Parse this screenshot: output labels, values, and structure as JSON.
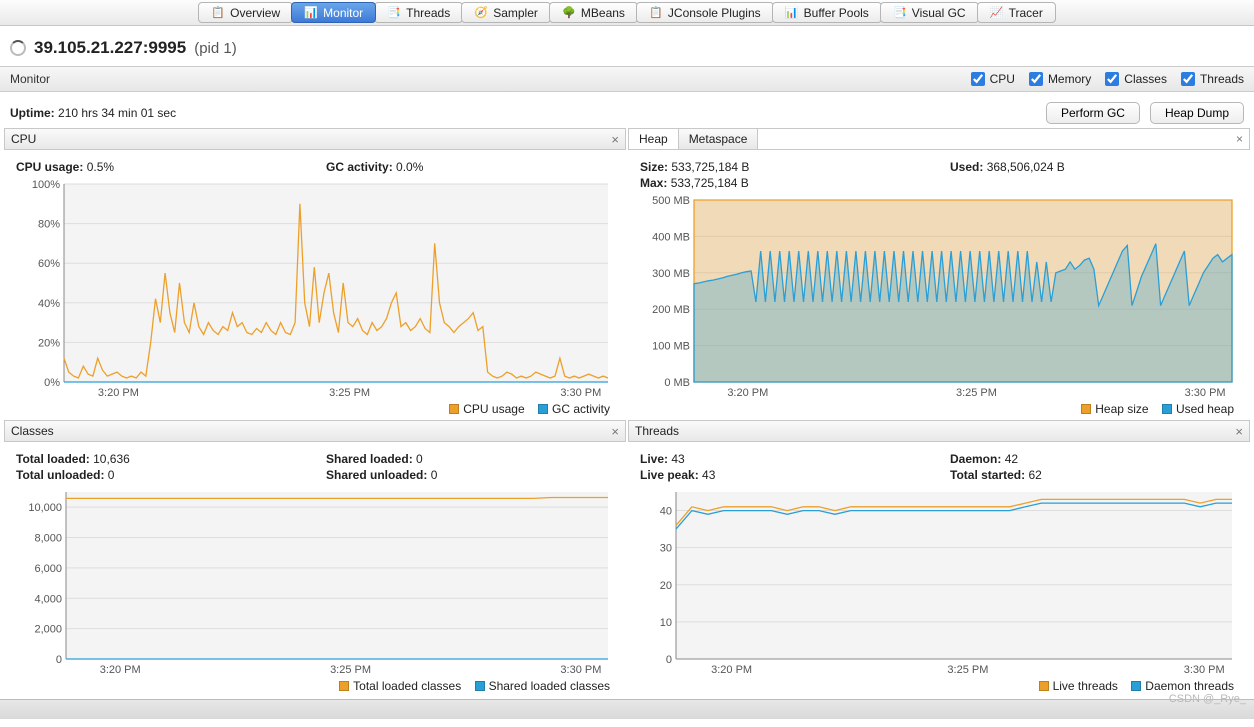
{
  "tabs": [
    {
      "label": "Overview",
      "icon": "📋"
    },
    {
      "label": "Monitor",
      "icon": "📊",
      "active": true
    },
    {
      "label": "Threads",
      "icon": "📑"
    },
    {
      "label": "Sampler",
      "icon": "🧭"
    },
    {
      "label": "MBeans",
      "icon": "🌳"
    },
    {
      "label": "JConsole Plugins",
      "icon": "📋"
    },
    {
      "label": "Buffer Pools",
      "icon": "📊"
    },
    {
      "label": "Visual GC",
      "icon": "📑"
    },
    {
      "label": "Tracer",
      "icon": "📈"
    }
  ],
  "header": {
    "title": "39.105.21.227:9995",
    "suffix": "(pid 1)"
  },
  "toolbar": {
    "label": "Monitor",
    "checks": [
      "CPU",
      "Memory",
      "Classes",
      "Threads"
    ]
  },
  "uptime": {
    "label": "Uptime:",
    "value": "210 hrs 34 min 01 sec"
  },
  "buttons": {
    "gc": "Perform GC",
    "dump": "Heap Dump"
  },
  "panels": {
    "cpu": {
      "title": "CPU",
      "stats": [
        {
          "label": "CPU usage:",
          "value": "0.5%"
        },
        {
          "label": "GC activity:",
          "value": "0.0%"
        }
      ],
      "legend": [
        {
          "color": "#eca02a",
          "text": "CPU usage"
        },
        {
          "color": "#2a9fd6",
          "text": "GC activity"
        }
      ]
    },
    "heap": {
      "tabs": [
        "Heap",
        "Metaspace"
      ],
      "stats_left": [
        {
          "label": "Size:",
          "value": "533,725,184 B"
        },
        {
          "label": "Max:",
          "value": "533,725,184 B"
        }
      ],
      "stats_right": [
        {
          "label": "Used:",
          "value": "368,506,024 B"
        }
      ],
      "legend": [
        {
          "color": "#eca02a",
          "text": "Heap size"
        },
        {
          "color": "#2a9fd6",
          "text": "Used heap"
        }
      ]
    },
    "classes": {
      "title": "Classes",
      "stats_left": [
        {
          "label": "Total loaded:",
          "value": "10,636"
        },
        {
          "label": "Total unloaded:",
          "value": "0"
        }
      ],
      "stats_right": [
        {
          "label": "Shared loaded:",
          "value": "0"
        },
        {
          "label": "Shared unloaded:",
          "value": "0"
        }
      ],
      "legend": [
        {
          "color": "#eca02a",
          "text": "Total loaded classes"
        },
        {
          "color": "#2a9fd6",
          "text": "Shared loaded classes"
        }
      ]
    },
    "threads": {
      "title": "Threads",
      "stats_left": [
        {
          "label": "Live:",
          "value": "43"
        },
        {
          "label": "Live peak:",
          "value": "43"
        }
      ],
      "stats_right": [
        {
          "label": "Daemon:",
          "value": "42"
        },
        {
          "label": "Total started:",
          "value": "62"
        }
      ],
      "legend": [
        {
          "color": "#eca02a",
          "text": "Live threads"
        },
        {
          "color": "#2a9fd6",
          "text": "Daemon threads"
        }
      ]
    }
  },
  "watermark": "CSDN @_Rye_",
  "chart_data": [
    {
      "type": "line",
      "title": "CPU",
      "x_ticks": [
        "3:20 PM",
        "3:25 PM",
        "3:30 PM"
      ],
      "ylim": [
        0,
        100
      ],
      "ylabel": "%",
      "y_ticks": [
        0,
        20,
        40,
        60,
        80,
        100
      ],
      "series": [
        {
          "name": "CPU usage",
          "color": "#eca02a",
          "values": [
            12,
            5,
            3,
            2,
            8,
            4,
            3,
            12,
            6,
            3,
            4,
            5,
            3,
            2,
            3,
            2,
            5,
            3,
            20,
            42,
            30,
            55,
            35,
            25,
            50,
            30,
            25,
            40,
            28,
            24,
            30,
            26,
            24,
            28,
            26,
            35,
            28,
            30,
            25,
            24,
            27,
            25,
            30,
            26,
            24,
            30,
            25,
            24,
            30,
            90,
            40,
            28,
            58,
            30,
            45,
            55,
            35,
            25,
            50,
            30,
            28,
            32,
            26,
            24,
            30,
            26,
            28,
            32,
            40,
            45,
            28,
            30,
            26,
            28,
            32,
            27,
            25,
            70,
            40,
            30,
            28,
            25,
            28,
            30,
            32,
            35,
            26,
            28,
            5,
            3,
            2,
            3,
            5,
            4,
            2,
            3,
            2,
            3,
            5,
            4,
            3,
            2,
            3,
            12,
            3,
            2,
            3,
            2,
            3,
            4,
            3,
            2,
            3,
            2
          ]
        },
        {
          "name": "GC activity",
          "color": "#2a9fd6",
          "values": [
            0,
            0,
            0,
            0,
            0,
            0,
            0,
            0,
            0,
            0,
            0,
            0,
            0,
            0,
            0,
            0,
            0,
            0,
            0,
            0,
            0,
            0,
            0,
            0,
            0,
            0,
            0,
            0,
            0,
            0,
            0,
            0,
            0,
            0,
            0,
            0,
            0,
            0,
            0,
            0,
            0,
            0,
            0,
            0,
            0,
            0,
            0,
            0,
            0,
            0,
            0,
            0,
            0,
            0,
            0,
            0,
            0,
            0,
            0,
            0,
            0,
            0,
            0,
            0,
            0,
            0,
            0,
            0,
            0,
            0,
            0,
            0,
            0,
            0,
            0,
            0,
            0,
            0,
            0,
            0,
            0,
            0,
            0,
            0,
            0,
            0,
            0,
            0,
            0,
            0,
            0,
            0,
            0,
            0,
            0,
            0,
            0,
            0,
            0,
            0,
            0,
            0,
            0,
            0,
            0,
            0,
            0,
            0,
            0,
            0,
            0,
            0,
            0,
            0
          ]
        }
      ]
    },
    {
      "type": "area",
      "title": "Heap",
      "x_ticks": [
        "3:20 PM",
        "3:25 PM",
        "3:30 PM"
      ],
      "ylim": [
        0,
        500
      ],
      "ylabel": "MB",
      "y_ticks": [
        0,
        100,
        200,
        300,
        400,
        500
      ],
      "series": [
        {
          "name": "Heap size",
          "color": "#eca02a",
          "fill": true,
          "values": [
            500,
            500,
            500,
            500,
            500,
            500,
            500,
            500,
            500,
            500,
            500,
            500,
            500,
            500,
            500,
            500,
            500,
            500,
            500,
            500,
            500,
            500,
            500,
            500,
            500,
            500,
            500,
            500,
            500,
            500,
            500,
            500,
            500,
            500,
            500,
            500,
            500,
            500,
            500,
            500,
            500,
            500,
            500,
            500,
            500,
            500,
            500,
            500,
            500,
            500,
            500,
            500,
            500,
            500,
            500,
            500,
            500,
            500,
            500,
            500,
            500,
            500,
            500,
            500,
            500,
            500,
            500,
            500,
            500,
            500,
            500,
            500,
            500,
            500,
            500,
            500,
            500,
            500,
            500,
            500,
            500,
            500,
            500,
            500,
            500,
            500,
            500,
            500,
            500,
            500,
            500,
            500,
            500,
            500,
            500,
            500,
            500,
            500,
            500,
            500,
            500,
            500,
            500,
            500,
            500,
            500,
            500,
            500,
            500,
            500,
            500,
            500,
            500,
            500
          ]
        },
        {
          "name": "Used heap",
          "color": "#2a9fd6",
          "fill": true,
          "values": [
            270,
            272,
            275,
            278,
            280,
            283,
            286,
            290,
            293,
            296,
            300,
            303,
            305,
            220,
            360,
            220,
            360,
            220,
            360,
            220,
            360,
            220,
            360,
            220,
            360,
            220,
            360,
            220,
            360,
            220,
            360,
            220,
            360,
            220,
            360,
            220,
            360,
            220,
            360,
            220,
            360,
            220,
            360,
            220,
            360,
            220,
            360,
            220,
            360,
            220,
            360,
            220,
            360,
            220,
            360,
            220,
            360,
            220,
            360,
            220,
            360,
            220,
            360,
            220,
            360,
            220,
            360,
            220,
            360,
            220,
            360,
            220,
            330,
            220,
            330,
            220,
            300,
            305,
            310,
            330,
            310,
            320,
            335,
            340,
            310,
            210,
            240,
            270,
            300,
            330,
            360,
            375,
            210,
            250,
            290,
            320,
            350,
            380,
            210,
            240,
            270,
            300,
            330,
            360,
            210,
            240,
            270,
            300,
            320,
            340,
            350,
            330,
            340,
            350
          ]
        }
      ]
    },
    {
      "type": "line",
      "title": "Classes",
      "x_ticks": [
        "3:20 PM",
        "3:25 PM",
        "3:30 PM"
      ],
      "ylim": [
        0,
        11000
      ],
      "y_ticks": [
        0,
        2000,
        4000,
        6000,
        8000,
        10000
      ],
      "series": [
        {
          "name": "Total loaded classes",
          "color": "#eca02a",
          "values": [
            10580,
            10580,
            10580,
            10580,
            10580,
            10580,
            10580,
            10580,
            10580,
            10580,
            10580,
            10580,
            10580,
            10580,
            10580,
            10580,
            10580,
            10580,
            10580,
            10580,
            10580,
            10580,
            10580,
            10580,
            10580,
            10580,
            10636,
            10636,
            10636,
            10636
          ]
        },
        {
          "name": "Shared loaded classes",
          "color": "#2a9fd6",
          "values": [
            0,
            0,
            0,
            0,
            0,
            0,
            0,
            0,
            0,
            0,
            0,
            0,
            0,
            0,
            0,
            0,
            0,
            0,
            0,
            0,
            0,
            0,
            0,
            0,
            0,
            0,
            0,
            0,
            0,
            0
          ]
        }
      ]
    },
    {
      "type": "line",
      "title": "Threads",
      "x_ticks": [
        "3:20 PM",
        "3:25 PM",
        "3:30 PM"
      ],
      "ylim": [
        0,
        45
      ],
      "y_ticks": [
        0,
        10,
        20,
        30,
        40
      ],
      "series": [
        {
          "name": "Live threads",
          "color": "#eca02a",
          "values": [
            36,
            41,
            40,
            41,
            41,
            41,
            41,
            40,
            41,
            41,
            40,
            41,
            41,
            41,
            41,
            41,
            41,
            41,
            41,
            41,
            41,
            41,
            42,
            43,
            43,
            43,
            43,
            43,
            43,
            43,
            43,
            43,
            43,
            42,
            43,
            43
          ]
        },
        {
          "name": "Daemon threads",
          "color": "#2a9fd6",
          "values": [
            35,
            40,
            39,
            40,
            40,
            40,
            40,
            39,
            40,
            40,
            39,
            40,
            40,
            40,
            40,
            40,
            40,
            40,
            40,
            40,
            40,
            40,
            41,
            42,
            42,
            42,
            42,
            42,
            42,
            42,
            42,
            42,
            42,
            41,
            42,
            42
          ]
        }
      ]
    }
  ]
}
